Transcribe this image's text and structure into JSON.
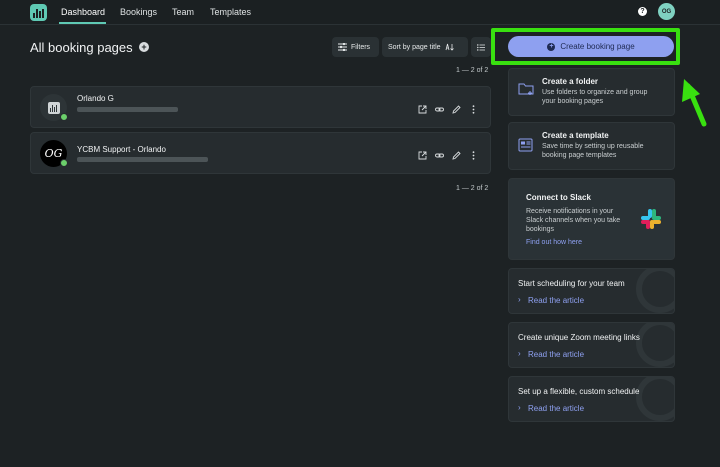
{
  "nav": {
    "tabs": [
      {
        "label": "Dashboard",
        "active": true
      },
      {
        "label": "Bookings",
        "active": false
      },
      {
        "label": "Team",
        "active": false
      },
      {
        "label": "Templates",
        "active": false
      }
    ],
    "help_icon": "question-circle-icon",
    "help_glyph": "?",
    "user_initials": "OG"
  },
  "header": {
    "title": "All booking pages",
    "add_glyph": "+",
    "filters_label": "Filters",
    "sort_label": "Sort by page title",
    "count_top": "1 — 2 of 2",
    "count_bottom": "1 — 2 of 2"
  },
  "booking_pages": [
    {
      "title": "Orlando G",
      "avatar": "logo",
      "online": true
    },
    {
      "title": "YCBM Support - Orlando",
      "avatar_initials": "OG",
      "online": true
    }
  ],
  "sidebar": {
    "create_button": "Create booking page",
    "create_plus": "+",
    "folder": {
      "title": "Create a folder",
      "desc": [
        "Use folders to organize and group",
        "your booking pages"
      ]
    },
    "template": {
      "title": "Create a template",
      "desc": [
        "Save time by setting up reusable",
        "booking page templates"
      ]
    },
    "slack": {
      "title": "Connect to Slack",
      "desc": [
        "Receive notifications in your",
        "Slack channels when you take",
        "bookings"
      ],
      "link": "Find out how here"
    },
    "articles": [
      {
        "title": "Start scheduling for your team",
        "link": "Read the article"
      },
      {
        "title": "Create unique Zoom meeting links",
        "link": "Read the article"
      },
      {
        "title": "Set up a flexible, custom schedule",
        "link": "Read the article"
      }
    ]
  },
  "colors": {
    "background": "#1d2224",
    "card": "#262c2f",
    "accent": "#5fc9b4",
    "primary_button": "#8ea0f0",
    "annotation": "#39e010"
  }
}
